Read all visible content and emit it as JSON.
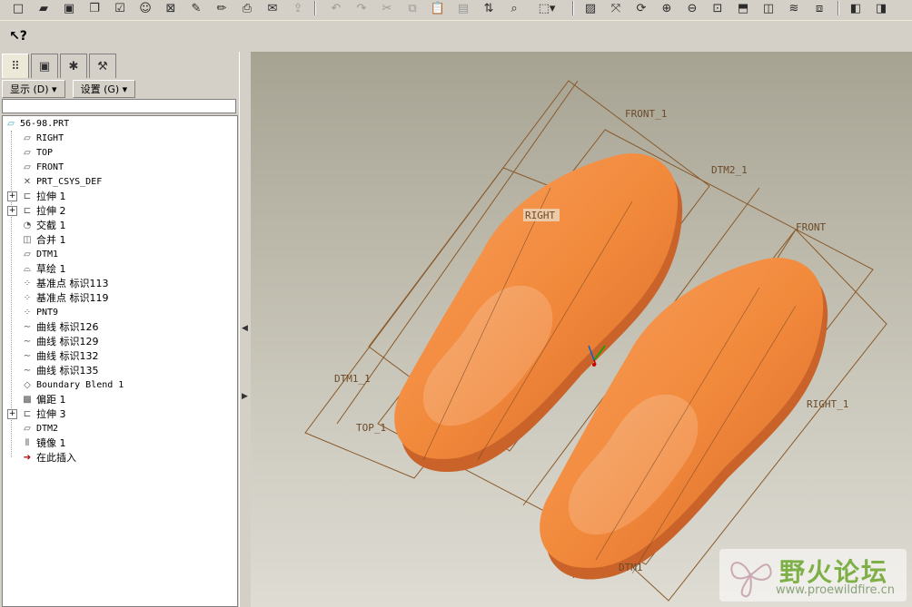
{
  "toolbar": {
    "icons": [
      "new-icon",
      "open-icon",
      "save-icon",
      "copy-icon",
      "checkbox-icon",
      "smile-icon",
      "close-window-icon",
      "edit-icon",
      "pencil-icon",
      "print-icon",
      "mail-icon",
      "send-icon",
      "undo-icon",
      "redo-icon",
      "cut-icon",
      "copy-icon",
      "paste-icon",
      "paste-special-icon",
      "regenerate-icon",
      "find-icon",
      "select-icon",
      "repaint-icon",
      "spin-icon",
      "orient-icon",
      "zoom-in-icon",
      "zoom-out-icon",
      "refit-icon",
      "view-icon",
      "saved-views-icon",
      "layers-icon",
      "view-manager-icon",
      "shading-icon",
      "wireframe-icon"
    ]
  },
  "help_button": {
    "label": "?"
  },
  "panel": {
    "tabs": [
      "model-tree-tab",
      "folder-tab",
      "favorites-tab",
      "tools-tab"
    ],
    "menus": {
      "display": "显示 (D) ▾",
      "settings": "设置 (G) ▾"
    }
  },
  "tree": {
    "root": "56-98.PRT",
    "items": [
      {
        "label": "RIGHT",
        "icon": "datum-plane-icon",
        "expandable": false
      },
      {
        "label": "TOP",
        "icon": "datum-plane-icon",
        "expandable": false
      },
      {
        "label": "FRONT",
        "icon": "datum-plane-icon",
        "expandable": false
      },
      {
        "label": "PRT_CSYS_DEF",
        "icon": "csys-icon",
        "expandable": false
      },
      {
        "label": "拉伸 1",
        "icon": "extrude-icon",
        "expandable": true
      },
      {
        "label": "拉伸 2",
        "icon": "extrude-icon",
        "expandable": true
      },
      {
        "label": "交截 1",
        "icon": "intersect-icon",
        "expandable": false
      },
      {
        "label": "合并 1",
        "icon": "merge-icon",
        "expandable": false
      },
      {
        "label": "DTM1",
        "icon": "datum-plane-icon",
        "expandable": false
      },
      {
        "label": "草绘 1",
        "icon": "sketch-icon",
        "expandable": false
      },
      {
        "label": "基准点 标识113",
        "icon": "datum-point-icon",
        "expandable": false
      },
      {
        "label": "基准点 标识119",
        "icon": "datum-point-icon",
        "expandable": false
      },
      {
        "label": "PNT9",
        "icon": "datum-point-icon",
        "expandable": false
      },
      {
        "label": "曲线 标识126",
        "icon": "curve-icon",
        "expandable": false
      },
      {
        "label": "曲线 标识129",
        "icon": "curve-icon",
        "expandable": false
      },
      {
        "label": "曲线 标识132",
        "icon": "curve-icon",
        "expandable": false
      },
      {
        "label": "曲线 标识135",
        "icon": "curve-icon",
        "expandable": false
      },
      {
        "label": "Boundary Blend 1",
        "icon": "boundary-blend-icon",
        "expandable": false
      },
      {
        "label": "偏距 1",
        "icon": "offset-icon",
        "expandable": false
      },
      {
        "label": "拉伸 3",
        "icon": "extrude-icon",
        "expandable": true
      },
      {
        "label": "DTM2",
        "icon": "datum-plane-icon",
        "expandable": false
      },
      {
        "label": "镜像 1",
        "icon": "mirror-icon",
        "expandable": false
      },
      {
        "label": "在此插入",
        "icon": "insert-here-icon",
        "expandable": false
      }
    ]
  },
  "viewport": {
    "datum_labels": {
      "front1": "FRONT_1",
      "dtm2": "DTM2_1",
      "right": "RIGHT",
      "front": "FRONT",
      "dtm1": "DTM1_1",
      "top1": "TOP_1",
      "right1": "RIGHT_1",
      "dtm1b": "DTM1"
    },
    "colors": {
      "shoe": "#f28a3c",
      "datum": "#8a5a2a"
    }
  },
  "watermark": {
    "title": "野火论坛",
    "url": "www.proewildfire.cn"
  }
}
